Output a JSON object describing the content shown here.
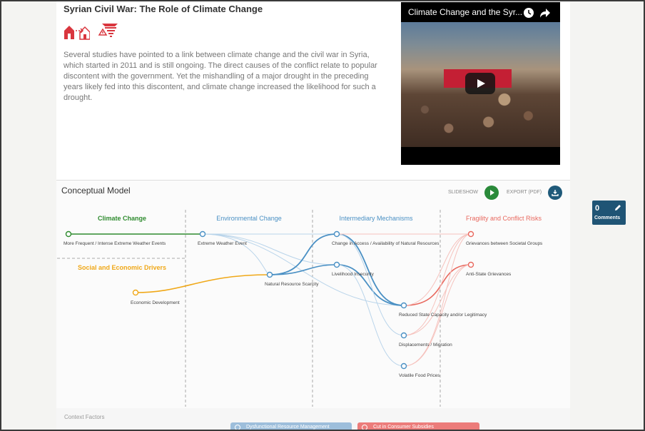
{
  "case": {
    "title": "Syrian Civil War: The Role of Climate Change",
    "description": "Several studies have pointed to a link between climate change and the civil war in Syria, which started in 2011 and is still ongoing. The direct causes of the conflict relate to popular discontent with the government. Yet the mishandling of a major drought in the preceding years likely fed into this discontent, and climate change increased the likelihood for such a drought.",
    "tags": [
      "migration-icon",
      "disaster-icon"
    ],
    "accent_color": "#d9363e"
  },
  "video": {
    "title": "Climate Change and the Syr...",
    "icons": [
      "clock-icon",
      "share-icon",
      "play-icon"
    ]
  },
  "model": {
    "title": "Conceptual Model",
    "slideshow_label": "SLIDESHOW",
    "export_label": "EXPORT (PDF)",
    "columns": {
      "climate": "Climate Change",
      "social": "Social and Economic Drivers",
      "environmental": "Environmental Change",
      "intermediary": "Intermediary Mechanisms",
      "fragility": "Fragility and Conflict Risks"
    },
    "nodes": {
      "n1": "More Frequent / Intense Extreme Weather Events",
      "n2": "Economic Development",
      "n3": "Extreme Weather Event",
      "n4": "Natural Resource Scarcity",
      "n5": "Change in Access / Availability of Natural Resources",
      "n6": "Livelihood Insecurity",
      "n7": "Reduced State Capacity and/or Legitimacy",
      "n8": "Displacements / Migration",
      "n9": "Volatile Food Prices",
      "n10": "Grievances between Societal Groups",
      "n11": "Anti-State Grievances"
    },
    "colors": {
      "climate": "#2e8b2e",
      "social": "#f0a818",
      "environmental": "#4a90c4",
      "intermediary": "#4a90c4",
      "fragility": "#e8685e"
    }
  },
  "context": {
    "label": "Context Factors",
    "chips": [
      "Dysfunctional Resource Management",
      "Cut in Consumer Subsidies"
    ]
  },
  "comments": {
    "count": "0",
    "label": "Comments"
  }
}
